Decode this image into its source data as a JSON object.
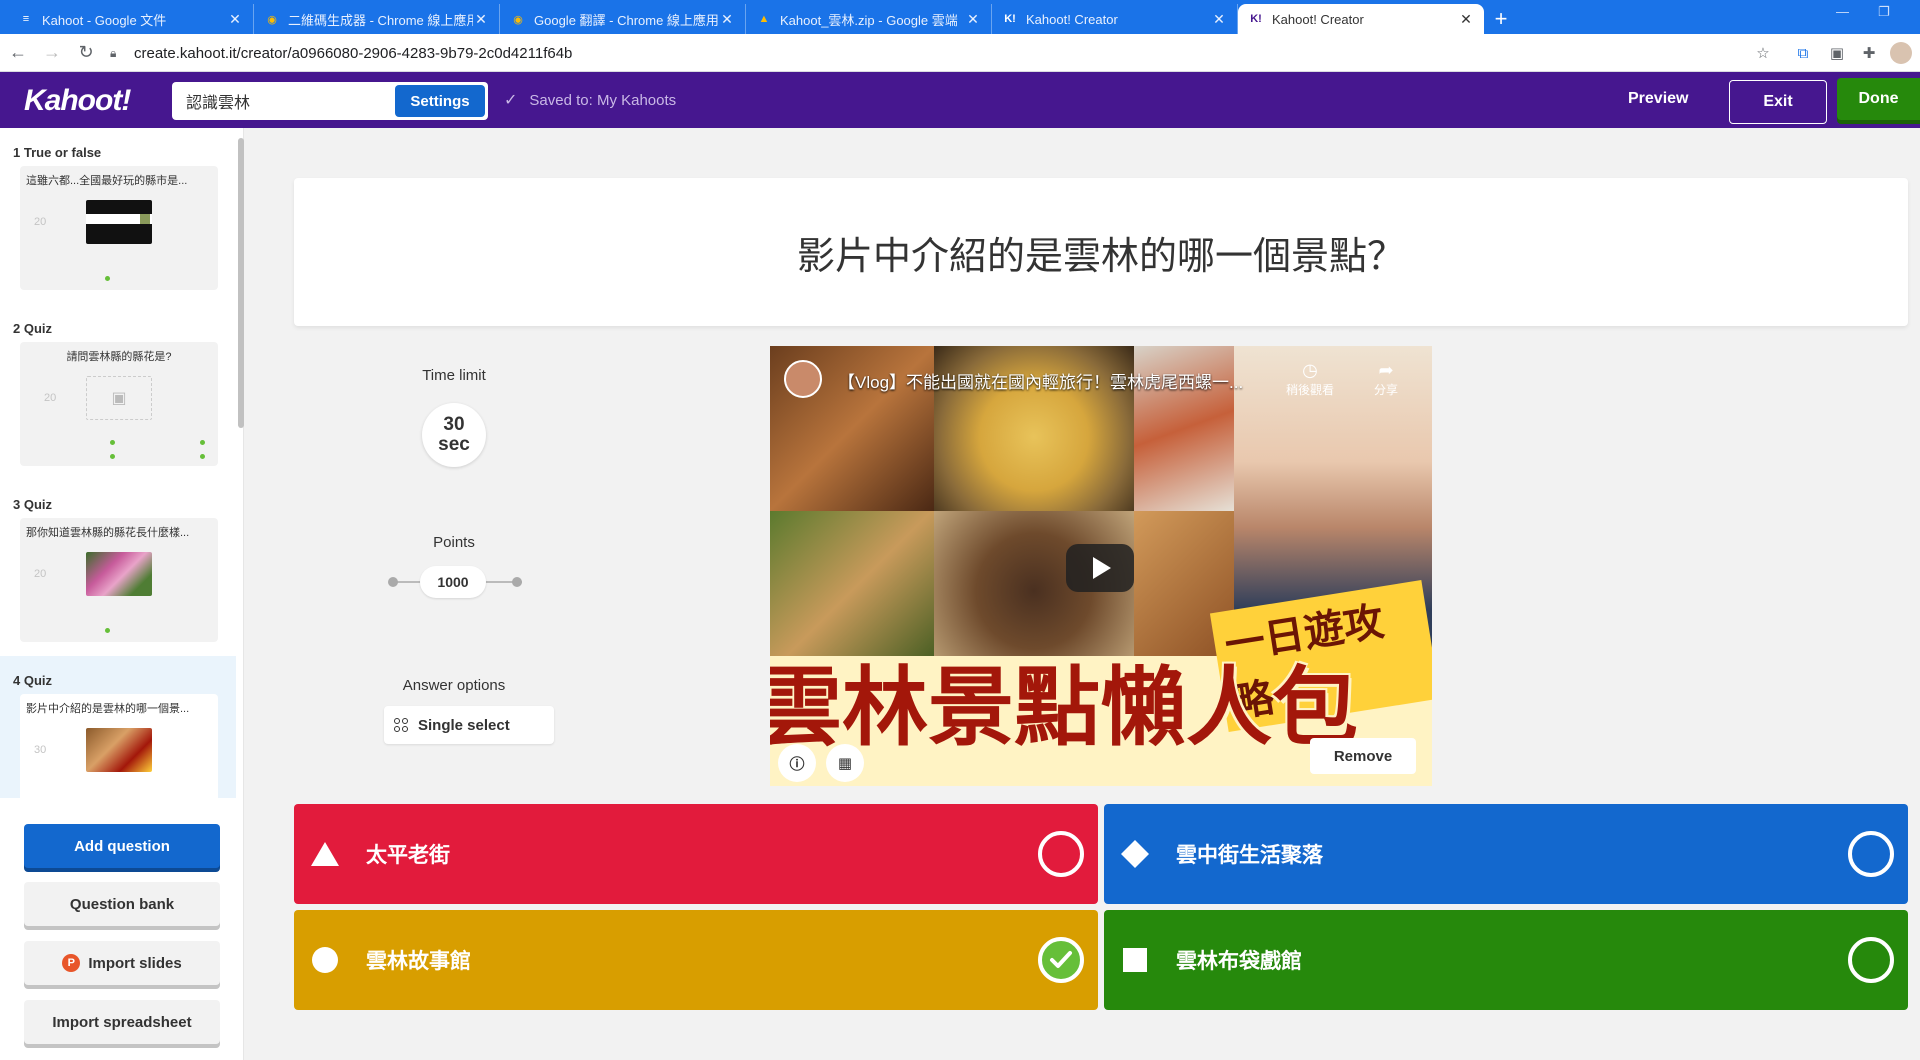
{
  "browser": {
    "tabs": [
      {
        "title": "Kahoot - Google 文件",
        "icon": "docs-icon"
      },
      {
        "title": "二維碼生成器 - Chrome 線上應用",
        "icon": "webstore-icon"
      },
      {
        "title": "Google 翻譯 - Chrome 線上應用",
        "icon": "webstore-icon"
      },
      {
        "title": "Kahoot_雲林.zip - Google 雲端",
        "icon": "drive-icon"
      },
      {
        "title": "Kahoot! Creator",
        "icon": "kahoot-icon"
      },
      {
        "title": "Kahoot! Creator",
        "icon": "kahoot-icon"
      }
    ],
    "new_tab": "+",
    "url": "create.kahoot.it/creator/a0966080-2906-4283-9b79-2c0d4211f64b"
  },
  "header": {
    "logo": "Kahoot!",
    "title_value": "認識雲林",
    "settings_label": "Settings",
    "saved_text": "Saved to: My Kahoots",
    "preview_label": "Preview",
    "exit_label": "Exit",
    "done_label": "Done"
  },
  "sidebar": {
    "slides": [
      {
        "label": "1  True or false",
        "question": "這雖六都...全國最好玩的縣市是...",
        "time": "20",
        "thumb": "bars"
      },
      {
        "label": "2  Quiz",
        "question": "請問雲林縣的縣花是?",
        "time": "20",
        "thumb": "placeholder"
      },
      {
        "label": "3  Quiz",
        "question": "那你知道雲林縣的縣花長什麼樣...",
        "time": "20",
        "thumb": "flowers"
      },
      {
        "label": "4  Quiz",
        "question": "影片中介紹的是雲林的哪一個景...",
        "time": "30",
        "thumb": "video"
      }
    ],
    "add_question_label": "Add question",
    "question_bank_label": "Question bank",
    "import_slides_label": "Import slides",
    "import_spreadsheet_label": "Import spreadsheet"
  },
  "editor": {
    "question": "影片中介紹的是雲林的哪一個景點？",
    "time_limit_label": "Time limit",
    "time_value": "30",
    "time_unit": "sec",
    "points_label": "Points",
    "points_value": "1000",
    "answer_options_label": "Answer options",
    "answer_mode": "Single select",
    "video": {
      "title": "【Vlog】不能出國就在國內輕旅行！雲林虎尾西螺一...",
      "watch_later": "稍後觀看",
      "share": "分享",
      "banner_sub": "一日遊攻略",
      "banner_main": "雲林景點懶人包",
      "remove_label": "Remove"
    },
    "answers": [
      {
        "text": "太平老街",
        "shape": "triangle",
        "color": "#e21b3c",
        "correct": false
      },
      {
        "text": "雲中街生活聚落",
        "shape": "diamond",
        "color": "#1368ce",
        "correct": false
      },
      {
        "text": "雲林故事館",
        "shape": "circle",
        "color": "#d89e00",
        "correct": true
      },
      {
        "text": "雲林布袋戲館",
        "shape": "square",
        "color": "#26890c",
        "correct": false
      }
    ]
  }
}
